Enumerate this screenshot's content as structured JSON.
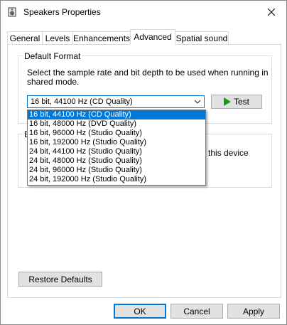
{
  "window": {
    "title": "Speakers Properties",
    "close_glyph": "✕"
  },
  "tabs": [
    "General",
    "Levels",
    "Enhancements",
    "Advanced",
    "Spatial sound"
  ],
  "active_tab": "Advanced",
  "default_format": {
    "group_label": "Default Format",
    "description": "Select the sample rate and bit depth to be used when running in shared mode.",
    "selected": "16 bit, 44100 Hz (CD Quality)",
    "options": [
      "16 bit, 44100 Hz (CD Quality)",
      "16 bit, 48000 Hz (DVD Quality)",
      "16 bit, 96000 Hz (Studio Quality)",
      "16 bit, 192000 Hz (Studio Quality)",
      "24 bit, 44100 Hz (Studio Quality)",
      "24 bit, 48000 Hz (Studio Quality)",
      "24 bit, 96000 Hz (Studio Quality)",
      "24 bit, 192000 Hz (Studio Quality)"
    ],
    "test_label": "Test"
  },
  "exclusive_mode": {
    "group_label_partial": "E",
    "text_partial": "this device"
  },
  "buttons": {
    "restore_defaults": "Restore Defaults",
    "ok": "OK",
    "cancel": "Cancel",
    "apply": "Apply"
  },
  "colors": {
    "accent": "#0078d7",
    "play": "#179c17"
  }
}
